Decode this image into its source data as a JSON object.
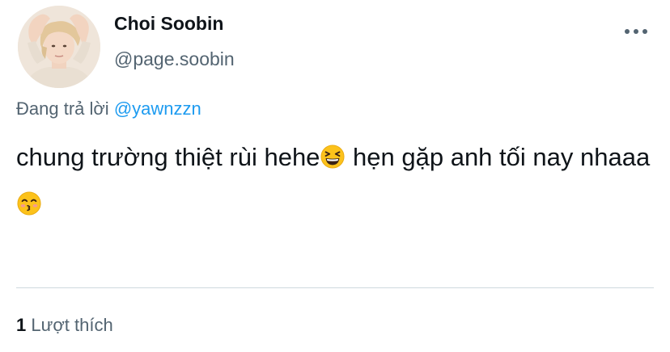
{
  "author": {
    "display_name": "Choi Soobin",
    "handle": "@page.soobin",
    "avatar_icon": "profile-photo"
  },
  "more_icon": "more-horizontal-icon",
  "reply": {
    "prefix": "Đang trả lời",
    "mention": "@yawnzzn"
  },
  "tweet": {
    "text_part1": "chung trường thiệt rùi hehe",
    "emoji1": "grinning-squinting-face",
    "text_part2": " hẹn gặp anh tối nay nhaaa",
    "emoji2": "kissing-face-with-smiling-eyes"
  },
  "stats": {
    "like_count": "1",
    "like_label": "Lượt thích"
  },
  "colors": {
    "text": "#0f1419",
    "secondary": "#536471",
    "link": "#1d9bf0",
    "divider": "#cfd9de"
  }
}
